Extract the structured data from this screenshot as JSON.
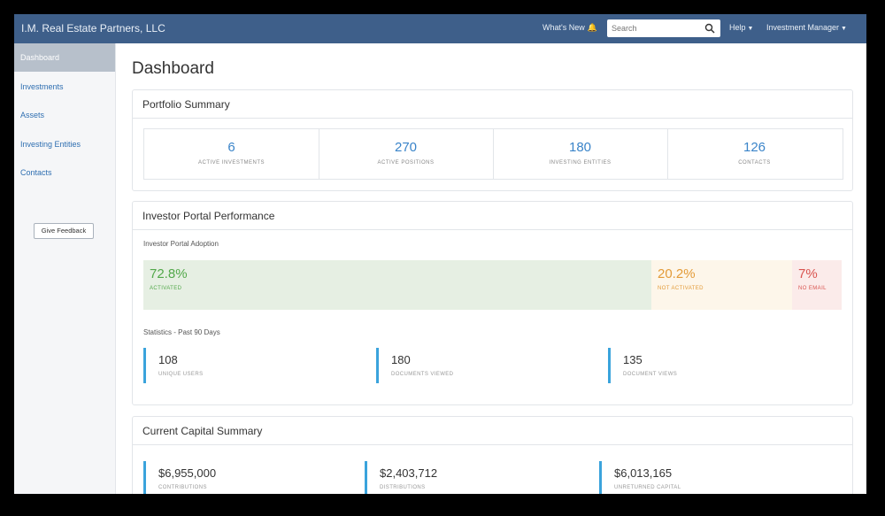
{
  "app": {
    "brand": "I.M. Real Estate Partners, LLC",
    "whats_new": "What's New",
    "search_placeholder": "Search",
    "help": "Help",
    "user_menu": "Investment Manager"
  },
  "sidebar": {
    "items": [
      {
        "label": "Dashboard",
        "active": true
      },
      {
        "label": "Investments"
      },
      {
        "label": "Assets"
      },
      {
        "label": "Investing Entities"
      },
      {
        "label": "Contacts"
      }
    ],
    "feedback": "Give Feedback"
  },
  "page": {
    "title": "Dashboard"
  },
  "portfolio": {
    "title": "Portfolio Summary",
    "stats": [
      {
        "value": "6",
        "label": "ACTIVE INVESTMENTS"
      },
      {
        "value": "270",
        "label": "ACTIVE POSITIONS"
      },
      {
        "value": "180",
        "label": "INVESTING ENTITIES"
      },
      {
        "value": "126",
        "label": "CONTACTS"
      }
    ]
  },
  "portal": {
    "title": "Investor Portal Performance",
    "adoption_label": "Investor Portal Adoption",
    "segments": [
      {
        "pct": "72.8%",
        "label": "ACTIVATED",
        "share": 0.728
      },
      {
        "pct": "20.2%",
        "label": "NOT ACTIVATED",
        "share": 0.202
      },
      {
        "pct": "7%",
        "label": "NO EMAIL",
        "share": 0.07
      }
    ],
    "stats_label": "Statistics - Past 90 Days",
    "metrics": [
      {
        "value": "108",
        "label": "UNIQUE USERS"
      },
      {
        "value": "180",
        "label": "DOCUMENTS VIEWED"
      },
      {
        "value": "135",
        "label": "DOCUMENT VIEWS"
      }
    ]
  },
  "capital": {
    "title": "Current Capital Summary",
    "metrics": [
      {
        "value": "$6,955,000",
        "label": "CONTRIBUTIONS"
      },
      {
        "value": "$2,403,712",
        "label": "DISTRIBUTIONS"
      },
      {
        "value": "$6,013,165",
        "label": "UNRETURNED CAPITAL"
      }
    ]
  },
  "colors": {
    "topbar": "#3e5f8a",
    "accent": "#3a84c9",
    "activated": "#52a84a",
    "not_activated": "#e39b38",
    "no_email": "#d9534f"
  }
}
